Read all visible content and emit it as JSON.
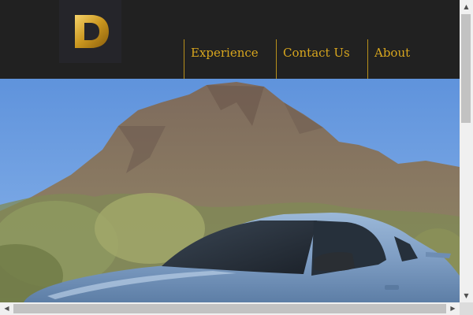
{
  "header": {
    "logo": {
      "letter": "D",
      "icon": "gold-d-logo"
    },
    "nav": {
      "experience": "Experience",
      "contact": "Contact Us",
      "about": "About"
    }
  },
  "hero": {
    "image": "blue-mustang-desert-mountain-photo"
  },
  "scrollbars": {
    "up_icon": "▲",
    "down_icon": "▼",
    "left_icon": "◀",
    "right_icon": "▶"
  },
  "colors": {
    "header_bg": "#212121",
    "nav_text": "#d8a61e",
    "sky": "#6f9fe0"
  }
}
